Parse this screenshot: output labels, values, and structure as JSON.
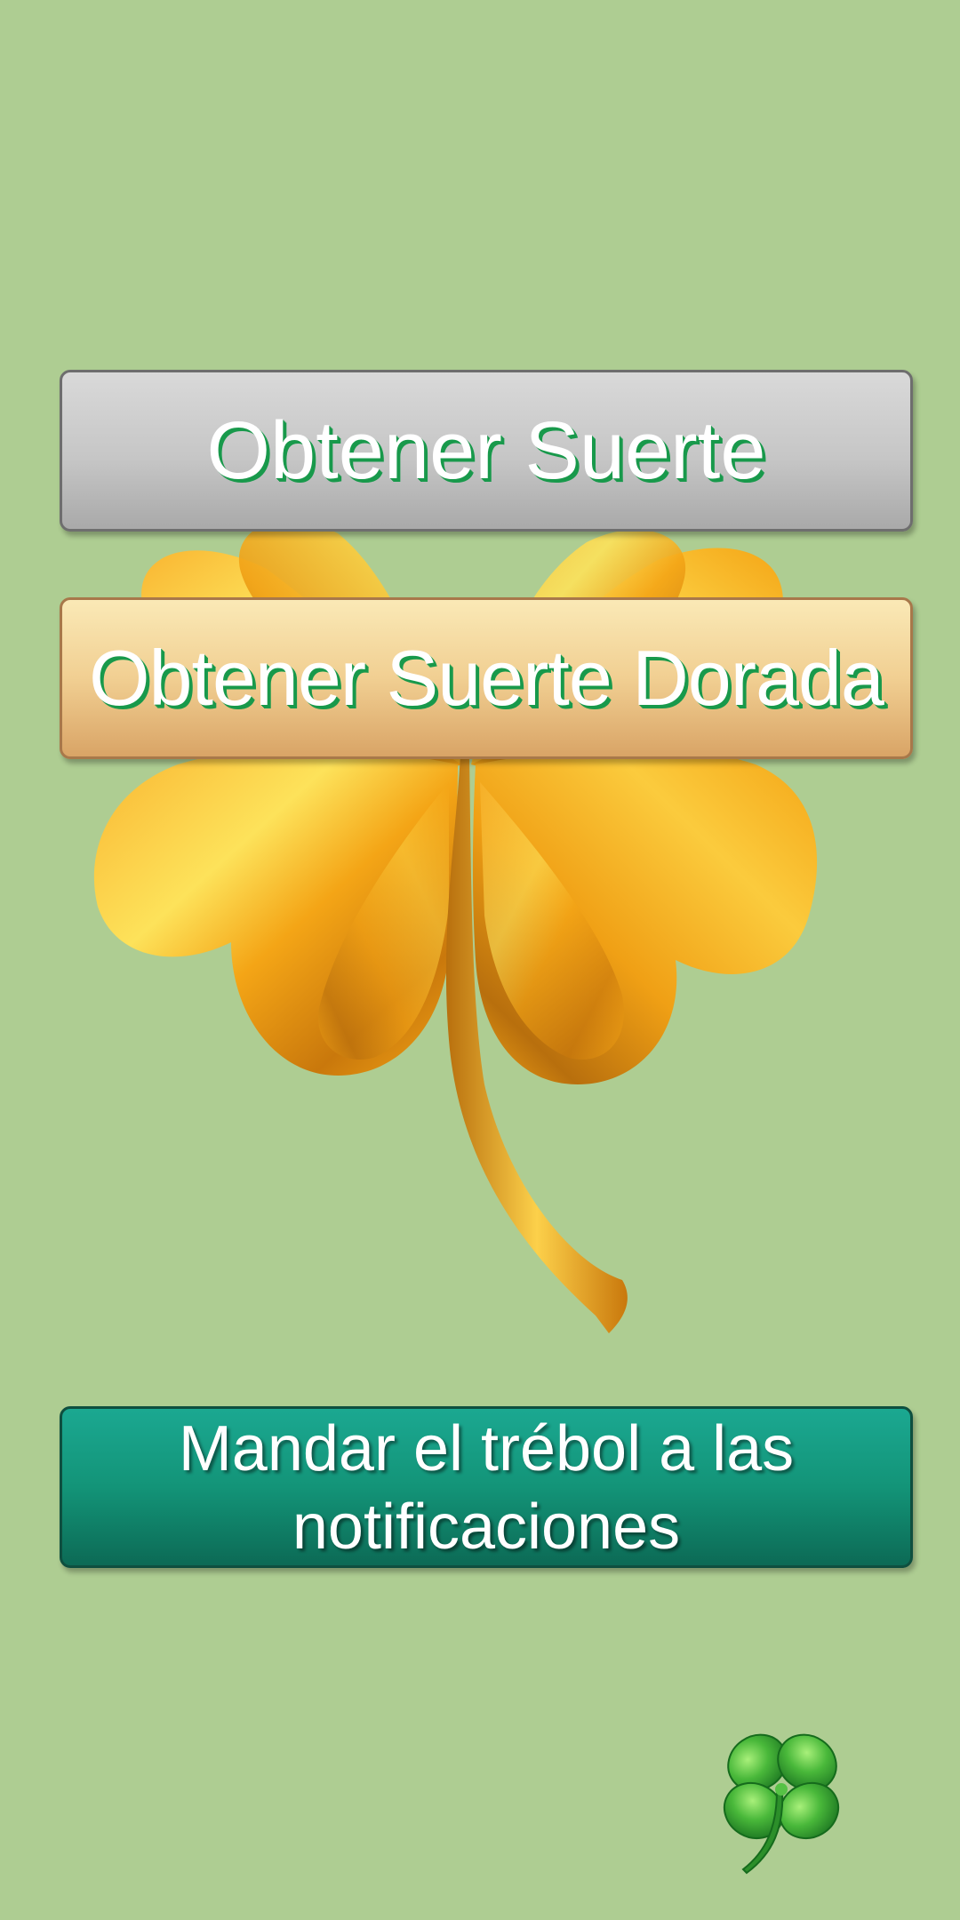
{
  "buttons": {
    "get_luck": "Obtener Suerte",
    "get_golden_luck": "Obtener Suerte Dorada",
    "send_to_notifications": "Mandar el trébol a las notificaciones"
  },
  "icons": {
    "main_illustration": "golden-clover-icon",
    "corner_icon": "green-clover-icon"
  },
  "colors": {
    "background": "#aecd92",
    "gold_leaf": "#f4a516",
    "green_text_shadow": "#18994b",
    "teal_button": "#139478"
  }
}
